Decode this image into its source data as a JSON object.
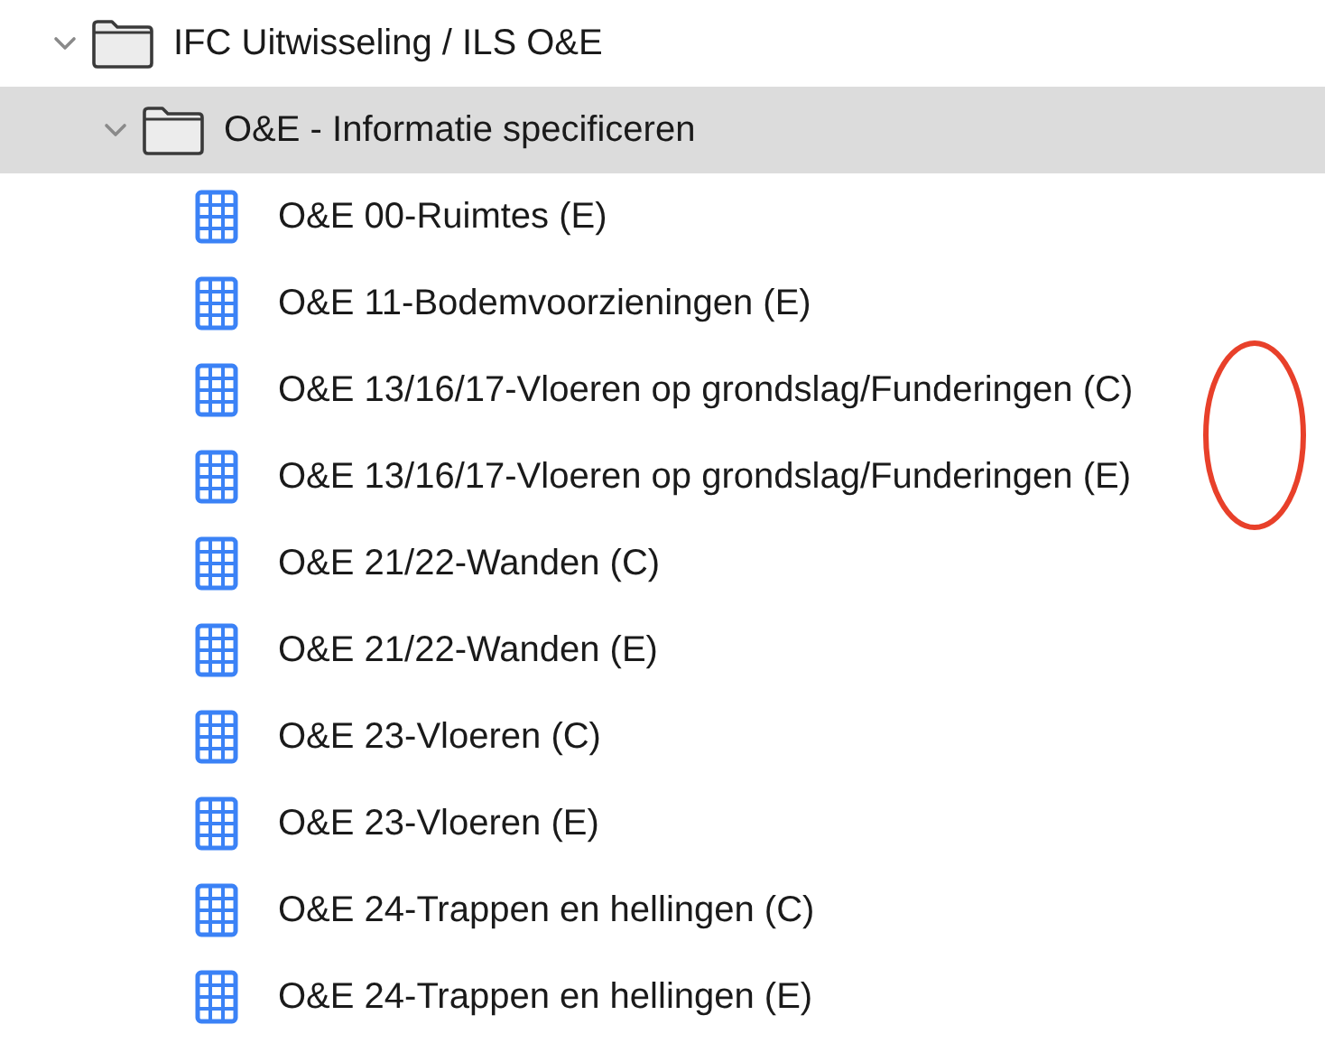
{
  "tree": [
    {
      "label": "IFC Uitwisseling / ILS O&E",
      "kind": "folder",
      "expanded": true,
      "selected": false,
      "children": [
        {
          "label": "O&E - Informatie specificeren",
          "kind": "folder",
          "expanded": true,
          "selected": true,
          "children": [
            {
              "label": "O&E 00-Ruimtes (E)",
              "kind": "table",
              "selected": false
            },
            {
              "label": "O&E 11-Bodemvoorzieningen (E)",
              "kind": "table",
              "selected": false
            },
            {
              "label": "O&E 13/16/17-Vloeren op grondslag/Funderingen (C)",
              "kind": "table",
              "selected": false
            },
            {
              "label": "O&E 13/16/17-Vloeren op grondslag/Funderingen (E)",
              "kind": "table",
              "selected": false
            },
            {
              "label": "O&E 21/22-Wanden (C)",
              "kind": "table",
              "selected": false
            },
            {
              "label": "O&E 21/22-Wanden (E)",
              "kind": "table",
              "selected": false
            },
            {
              "label": "O&E 23-Vloeren (C)",
              "kind": "table",
              "selected": false
            },
            {
              "label": "O&E 23-Vloeren (E)",
              "kind": "table",
              "selected": false
            },
            {
              "label": "O&E 24-Trappen en hellingen (C)",
              "kind": "table",
              "selected": false
            },
            {
              "label": "O&E 24-Trappen en hellingen (E)",
              "kind": "table",
              "selected": false
            }
          ]
        }
      ]
    }
  ],
  "annotations": [
    {
      "kind": "ellipse",
      "color": "#e8402a"
    }
  ]
}
